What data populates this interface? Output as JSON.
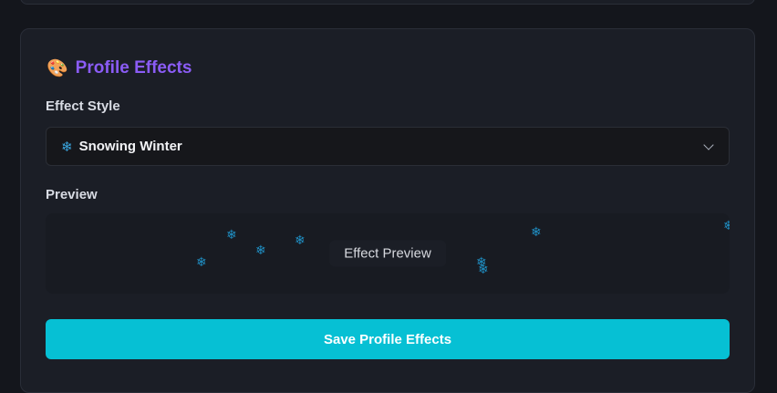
{
  "profile_effects": {
    "title": "Profile Effects",
    "title_icon": "palette-icon",
    "effect_style_label": "Effect Style",
    "select": {
      "icon": "snowflake-icon",
      "selected_value": "Snowing Winter"
    },
    "preview_label": "Preview",
    "preview_text": "Effect Preview",
    "save_button_label": "Save Profile Effects"
  },
  "colors": {
    "accent_title": "#8b5cf6",
    "button": "#06c0d4",
    "snowflake": "#1f8fc4"
  }
}
